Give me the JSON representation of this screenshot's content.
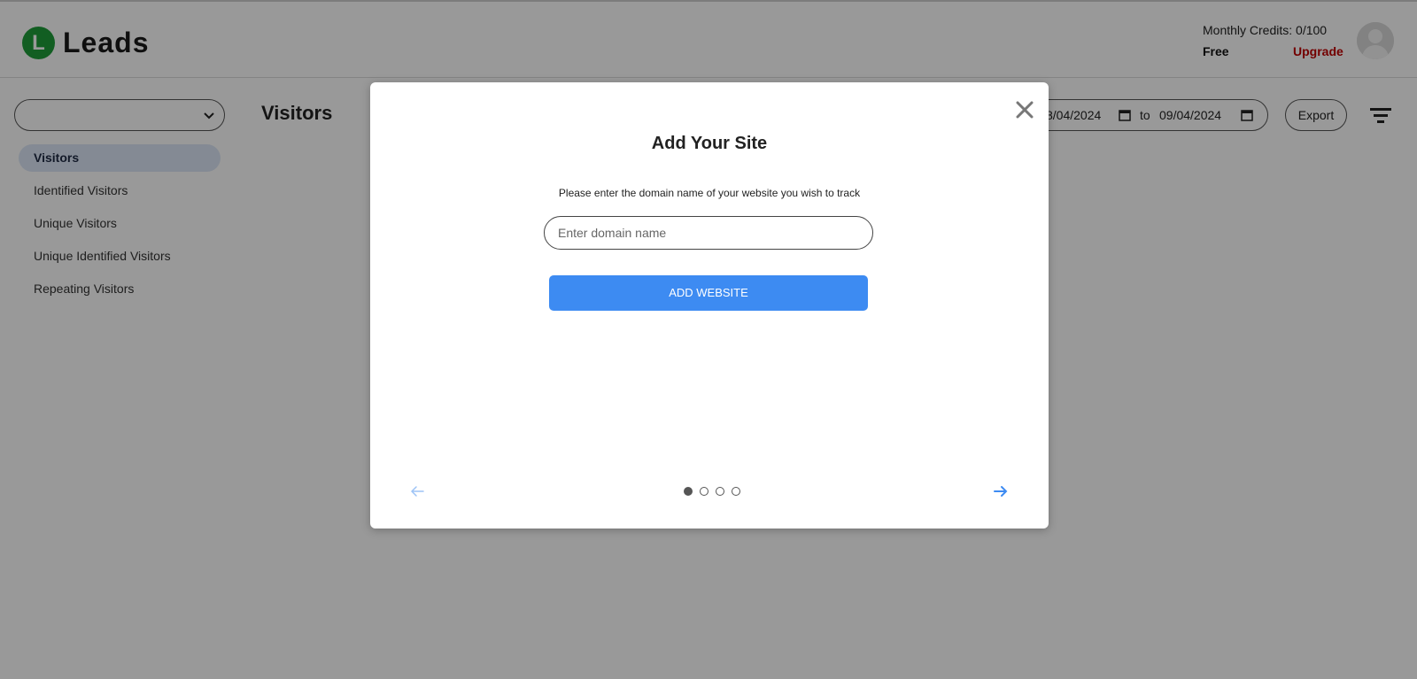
{
  "header": {
    "logo_letter": "L",
    "logo_text": "Leads",
    "credits": "Monthly Credits: 0/100",
    "plan": "Free",
    "upgrade_label": "Upgrade"
  },
  "sidebar": {
    "site_select_value": "",
    "items": [
      {
        "label": "Visitors",
        "active": true
      },
      {
        "label": "Identified Visitors",
        "active": false
      },
      {
        "label": "Unique Visitors",
        "active": false
      },
      {
        "label": "Unique Identified Visitors",
        "active": false
      },
      {
        "label": "Repeating Visitors",
        "active": false
      }
    ]
  },
  "main": {
    "title": "Visitors",
    "date_from": "8/04/2024",
    "to_label": "to",
    "date_to": "09/04/2024",
    "export_label": "Export"
  },
  "modal": {
    "title": "Add Your Site",
    "subtitle": "Please enter the domain name of your website you wish to track",
    "input_placeholder": "Enter domain name",
    "input_value": "",
    "button_label": "ADD WEBSITE",
    "total_steps": 4,
    "current_step": 1
  },
  "colors": {
    "brand_green": "#1f9d3a",
    "upgrade_red": "#c00000",
    "primary_blue": "#3d8bf2",
    "active_nav_bg": "#dde7f7"
  }
}
